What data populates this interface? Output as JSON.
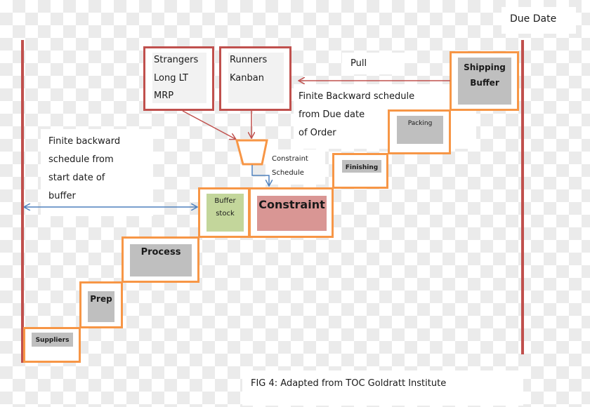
{
  "title_label": "Due Date",
  "sources": {
    "strangers": [
      "Strangers",
      "Long LT",
      "MRP"
    ],
    "runners": [
      "Runners",
      "Kanban"
    ]
  },
  "pull_label": "Pull",
  "finite_backward_due": [
    "Finite Backward schedule",
    "from Due date",
    "of Order"
  ],
  "finite_backward_buffer": [
    "Finite backward",
    "schedule from",
    "start date of",
    "buffer"
  ],
  "constraint_schedule": [
    "Constraint",
    "Schedule"
  ],
  "steps": {
    "suppliers": "Suppliers",
    "prep": "Prep",
    "process": "Process",
    "buffer_stock": [
      "Buffer",
      "stock"
    ],
    "constraint": "Constraint",
    "finishing": "Finishing",
    "packing": "Packing",
    "shipping_buffer": [
      "Shipping",
      "Buffer"
    ]
  },
  "caption": "FIG 4: Adapted from TOC Goldratt Institute",
  "colors": {
    "red_line": "#c0504d",
    "orange_step": "#f79646",
    "blue_arrow": "#4f81bd",
    "gray_label": "#bfbfbf",
    "buffer_green": "#c3d69b",
    "constraint_red": "#d99694"
  }
}
